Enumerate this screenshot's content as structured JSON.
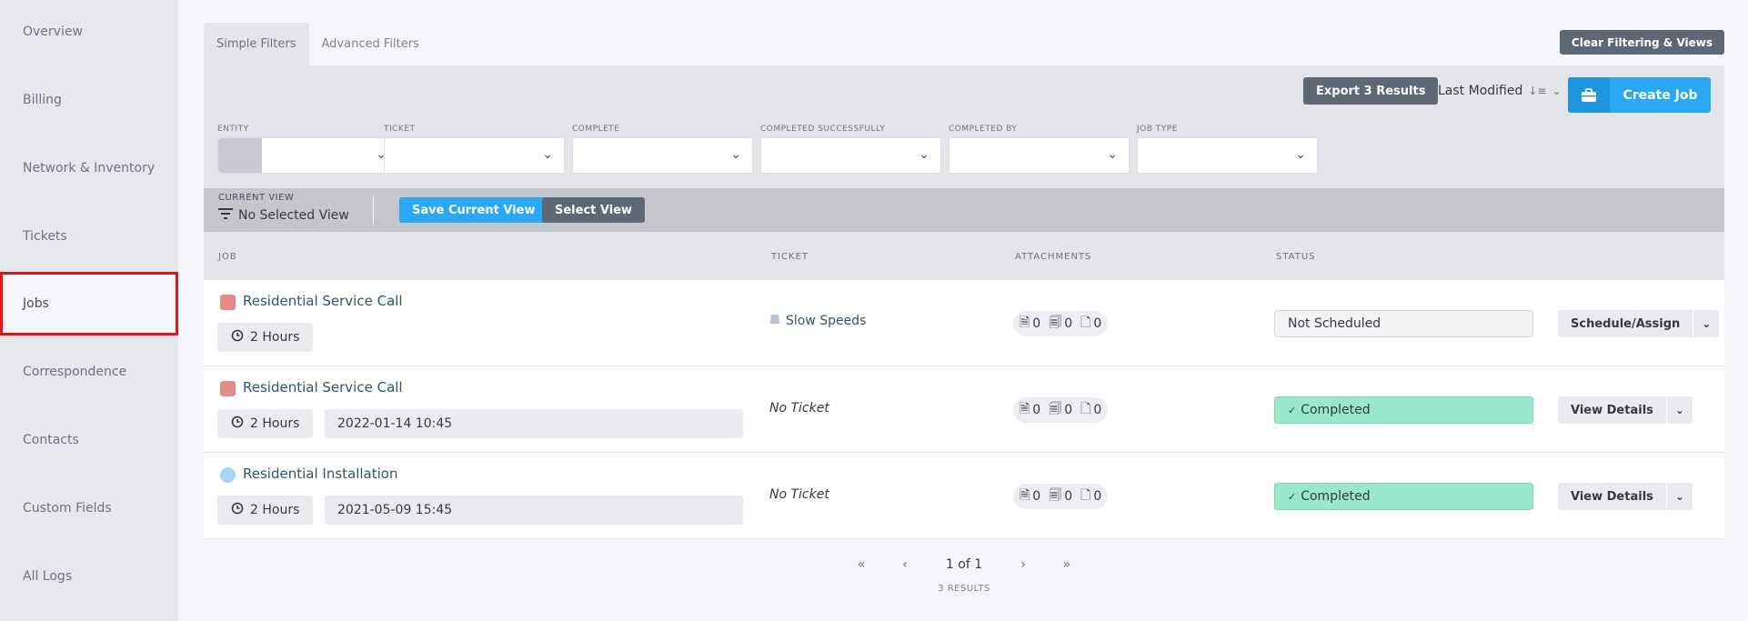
{
  "sidebar": {
    "items": [
      {
        "label": "Overview"
      },
      {
        "label": "Billing"
      },
      {
        "label": "Network & Inventory"
      },
      {
        "label": "Tickets"
      },
      {
        "label": "Jobs",
        "selected": true
      },
      {
        "label": "Correspondence"
      },
      {
        "label": "Contacts"
      },
      {
        "label": "Custom Fields"
      },
      {
        "label": "All Logs"
      }
    ]
  },
  "tabs": {
    "simple": "Simple Filters",
    "advanced": "Advanced Filters"
  },
  "toolbar": {
    "clear": "Clear Filtering & Views",
    "export": "Export 3 Results",
    "sort": "Last Modified",
    "create": "Create Job"
  },
  "filters": {
    "entity": "ENTITY",
    "ticket": "TICKET",
    "complete": "COMPLETE",
    "completed_successfully": "COMPLETED SUCCESSFULLY",
    "completed_by": "COMPLETED BY",
    "job_type": "JOB TYPE"
  },
  "view": {
    "label": "CURRENT VIEW",
    "value": "No Selected View",
    "save": "Save Current View",
    "select": "Select View"
  },
  "columns": {
    "job": "JOB",
    "ticket": "TICKET",
    "attachments": "ATTACHMENTS",
    "status": "STATUS"
  },
  "rows": [
    {
      "title": "Residential Service Call",
      "duration": "2 Hours",
      "date": "",
      "ticket": "Slow Speeds",
      "attachments": [
        "0",
        "0",
        "0"
      ],
      "status": "Not Scheduled",
      "action": "Schedule/Assign",
      "marker_color": "#e68a8a"
    },
    {
      "title": "Residential Service Call",
      "duration": "2 Hours",
      "date": "2022-01-14 10:45",
      "ticket": "No Ticket",
      "attachments": [
        "0",
        "0",
        "0"
      ],
      "status": "Completed",
      "action": "View Details",
      "marker_color": "#e68a8a"
    },
    {
      "title": "Residential Installation",
      "duration": "2 Hours",
      "date": "2021-05-09 15:45",
      "ticket": "No Ticket",
      "attachments": [
        "0",
        "0",
        "0"
      ],
      "status": "Completed",
      "action": "View Details",
      "marker_color": "#a9d4fb"
    }
  ],
  "pagination": {
    "first": "«",
    "prev": "‹",
    "current": "1",
    "of": "of 1",
    "next": "›",
    "last": "»",
    "results": "3 RESULTS"
  },
  "colors": {
    "accent": "#2aa8f3",
    "dark_button": "#5d6874",
    "completed": "#99e8c7",
    "selection_outline": "#e81313"
  }
}
